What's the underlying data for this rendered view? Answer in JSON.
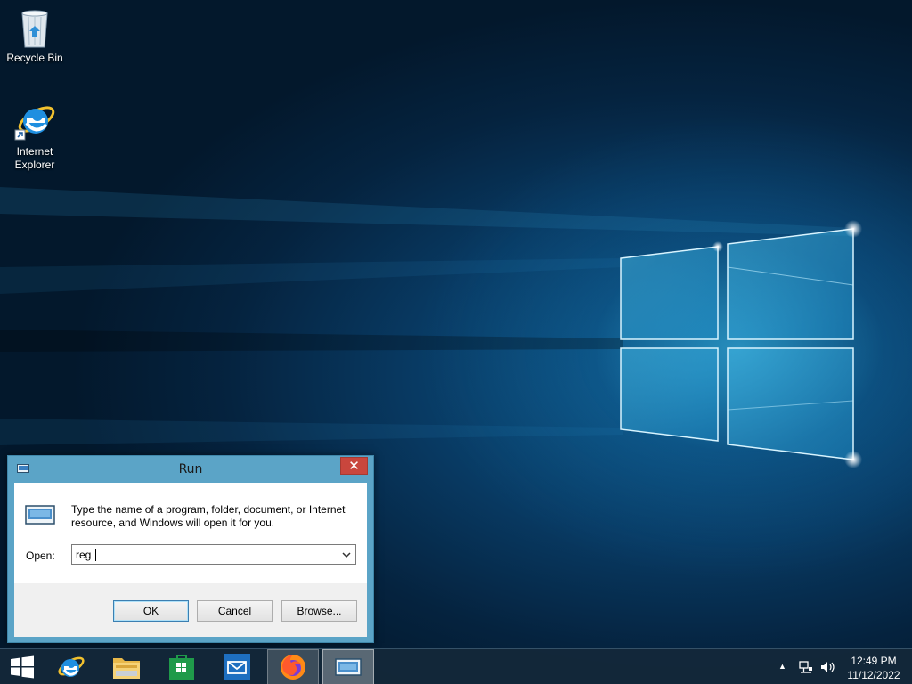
{
  "desktop": {
    "icons": [
      {
        "label": "Recycle Bin"
      },
      {
        "label": "Internet Explorer"
      }
    ]
  },
  "run_dialog": {
    "title": "Run",
    "close_label": "✕",
    "description": "Type the name of a program, folder, document, or Internet resource, and Windows will open it for you.",
    "open_label": "Open:",
    "open_value": "reg",
    "ok_label": "OK",
    "cancel_label": "Cancel",
    "browse_label": "Browse..."
  },
  "taskbar": {
    "items": [
      "start-button",
      "internet-explorer",
      "file-explorer",
      "store",
      "mail",
      "firefox",
      "run"
    ],
    "tray_arrow": "▲",
    "clock": {
      "time": "12:49 PM",
      "date": "11/12/2022"
    }
  },
  "colors": {
    "dialog_frame": "#5ba4c7",
    "close_button": "#c9463d",
    "taskbar": "#14283a"
  }
}
